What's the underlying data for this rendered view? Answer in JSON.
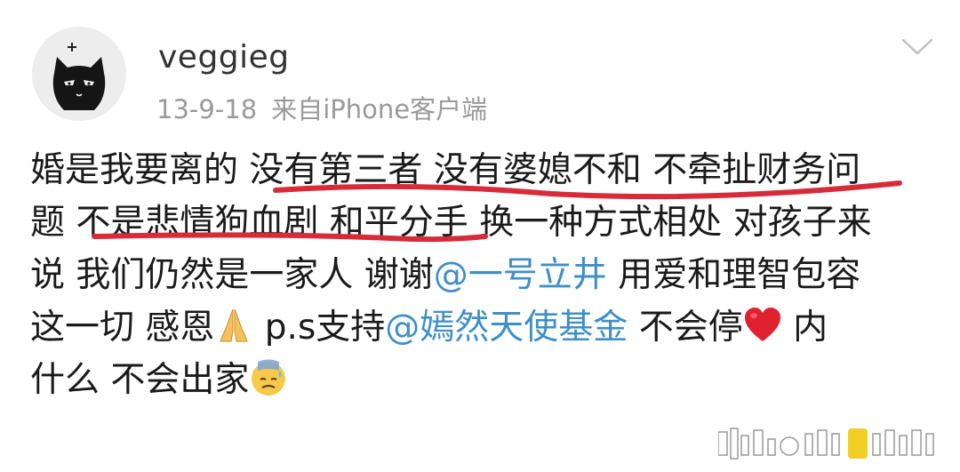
{
  "post": {
    "username": "veggieg",
    "date": "13-9-18",
    "source": "来自iPhone客户端",
    "lines": [
      {
        "text": "婚是我要离的 没有第三者 没有婆媳不和 不牵扯财务问"
      },
      {
        "text": "题 不是悲情狗血剧 和平分手 换一种方式相处 对孩子来"
      },
      {
        "before": "说 我们仍然是一家人 谢谢",
        "mention": "@一号立井",
        "after": " 用爱和理智包容"
      },
      {
        "before": "这一切 感恩",
        "middle": " p.s支持",
        "mention": "@嫣然天使基金",
        "after": " 不会停",
        "tail": " 内"
      },
      {
        "text": "什么 不会出家"
      }
    ],
    "emojis": [
      "praying-hands",
      "red-heart",
      "sweat-face"
    ],
    "accent_color": "#3f8fc7",
    "underline_color": "#d62c3a"
  }
}
